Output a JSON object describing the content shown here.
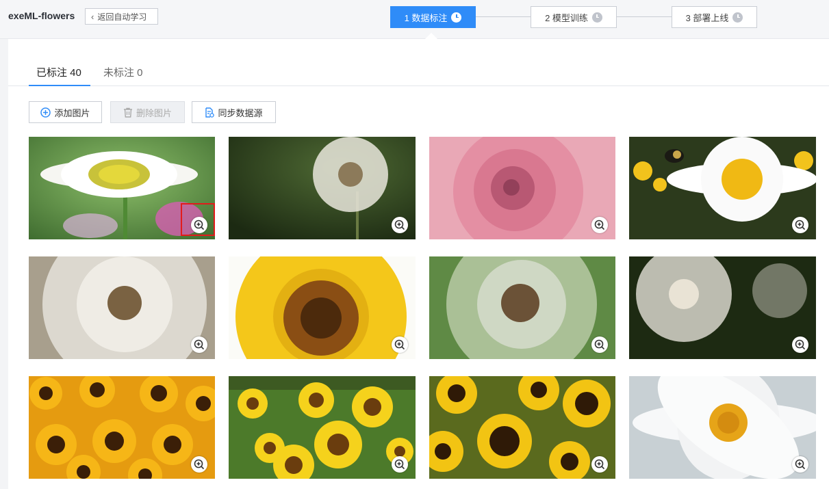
{
  "app": {
    "title": "exeML-flowers",
    "back_label": "返回自动学习"
  },
  "steps": [
    {
      "label": "1 数据标注",
      "active": true
    },
    {
      "label": "2 模型训练",
      "active": false
    },
    {
      "label": "3 部署上线",
      "active": false
    }
  ],
  "tabs": {
    "labeled": "已标注 40",
    "unlabeled": "未标注 0"
  },
  "toolbar": {
    "add_label": "添加图片",
    "delete_label": "删除图片",
    "sync_label": "同步数据源"
  },
  "images": [
    {
      "kind": "daisy-field",
      "icon": "zoom-in-icon"
    },
    {
      "kind": "dandelion-seedhead",
      "icon": "zoom-in-icon"
    },
    {
      "kind": "pink-rose",
      "icon": "zoom-in-icon"
    },
    {
      "kind": "daisy-bee",
      "icon": "zoom-in-icon"
    },
    {
      "kind": "dandelion-closeup",
      "icon": "zoom-in-icon"
    },
    {
      "kind": "sunflower-closeup",
      "icon": "zoom-in-icon"
    },
    {
      "kind": "dandelion-green",
      "icon": "zoom-in-icon"
    },
    {
      "kind": "dandelion-dark",
      "icon": "zoom-in-icon"
    },
    {
      "kind": "sunflower-crowd",
      "icon": "zoom-in-icon"
    },
    {
      "kind": "sunflower-field",
      "icon": "zoom-in-icon"
    },
    {
      "kind": "sunflower-bunch",
      "icon": "zoom-in-icon"
    },
    {
      "kind": "white-daisy",
      "icon": "zoom-in-icon"
    }
  ],
  "colors": {
    "accent": "#2f8cf8",
    "highlight": "#e21b1b"
  }
}
